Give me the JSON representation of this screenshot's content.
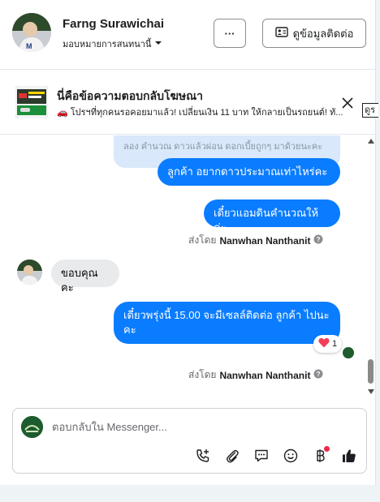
{
  "header": {
    "name": "Farng Surawichai",
    "assignee": "มอบหมายการสนทนานี้",
    "more_label": "···",
    "contact_label": "ดูข้อมูลติดต่อ"
  },
  "ad": {
    "title": "นี่คือข้อความตอบกลับโฆษณา",
    "text": "🚗 โปรฯที่ทุกคนรอคอยมาแล้ว! เปลี่ยนเงิน 11 บาท ให้กลายเป็นรถยนต์! ทั...",
    "link_label": "ดูร"
  },
  "messages": {
    "faded": "ลอง คำนวณ ดาวแล้วผ่อน ดอกเบี้ยถูกๆ มาด้วยนะคะ",
    "out1": "ลูกค้า  อยากดาวประมาณเท่าไหร่คะ",
    "out2": "เดี๋ยวแอมดินคำนวณให้ค่ะ",
    "sent1_prefix": "ส่งโดย",
    "sent1_name": "Nanwhan Nanthanit",
    "in1": "ขอบคุณคะ",
    "out3": "เดี๋ยวพรุ่งนี้ 15.00 จะมีเซลล์ติดต่อ ลูกค้า ไปนะคะ",
    "reaction_count": "1",
    "sent2_prefix": "ส่งโดย",
    "sent2_name": "Nanwhan Nanthanit"
  },
  "composer": {
    "placeholder": "ตอบกลับใน Messenger..."
  },
  "colors": {
    "accent": "#0a7cff",
    "incoming_bubble": "#e9eaec",
    "badge": "#f02849"
  }
}
